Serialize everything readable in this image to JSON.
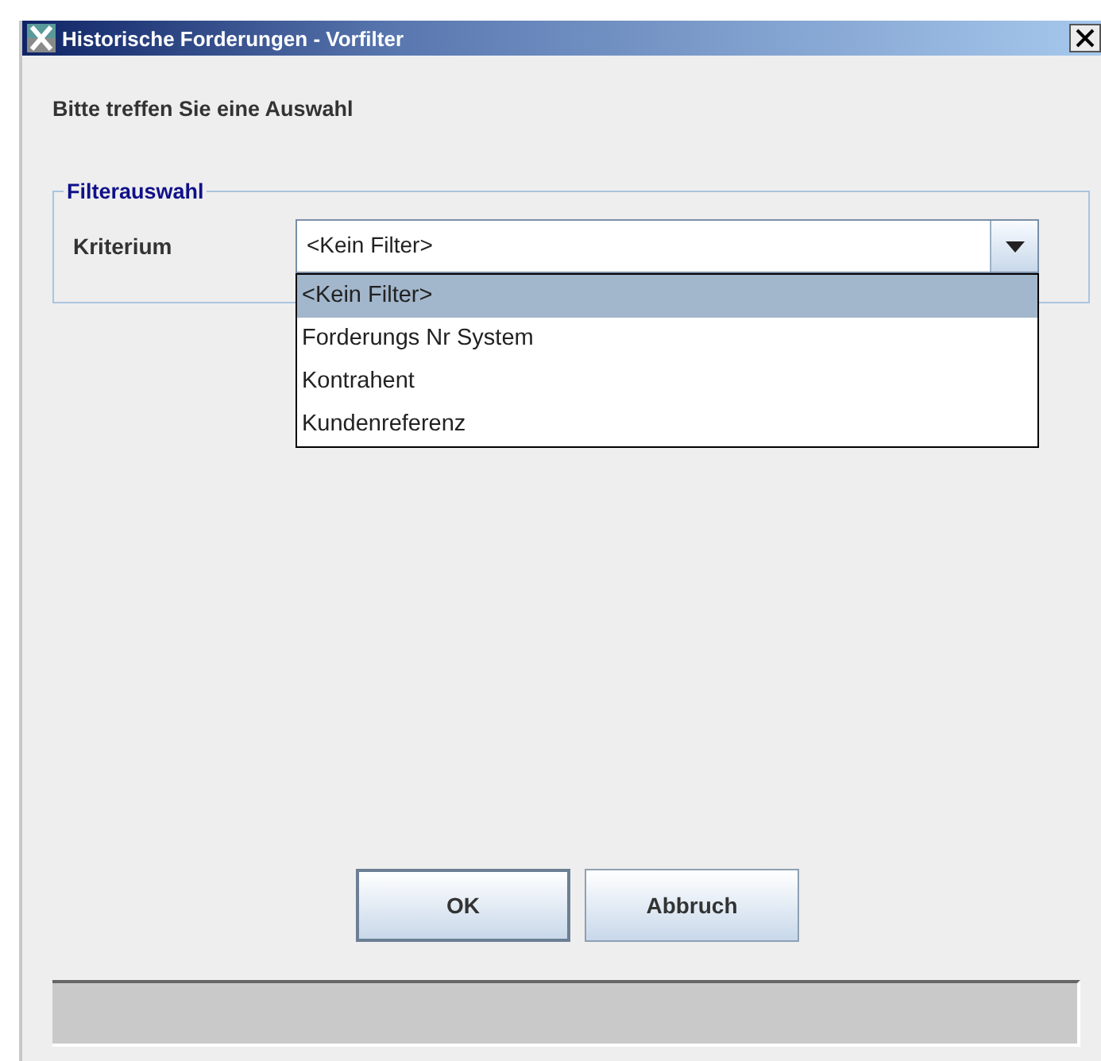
{
  "window": {
    "title": "Historische Forderungen - Vorfilter"
  },
  "prompt": "Bitte treffen Sie eine Auswahl",
  "filter_group": {
    "legend": "Filterauswahl",
    "label": "Kriterium",
    "combo": {
      "value": "<Kein Filter>",
      "expanded": true
    },
    "options": [
      {
        "label": "<Kein Filter>",
        "selected": true
      },
      {
        "label": "Forderungs Nr System",
        "selected": false
      },
      {
        "label": "Kontrahent",
        "selected": false
      },
      {
        "label": "Kundenreferenz",
        "selected": false
      }
    ]
  },
  "buttons": [
    {
      "label": "OK",
      "default": true
    },
    {
      "label": "Abbruch",
      "default": false
    }
  ]
}
